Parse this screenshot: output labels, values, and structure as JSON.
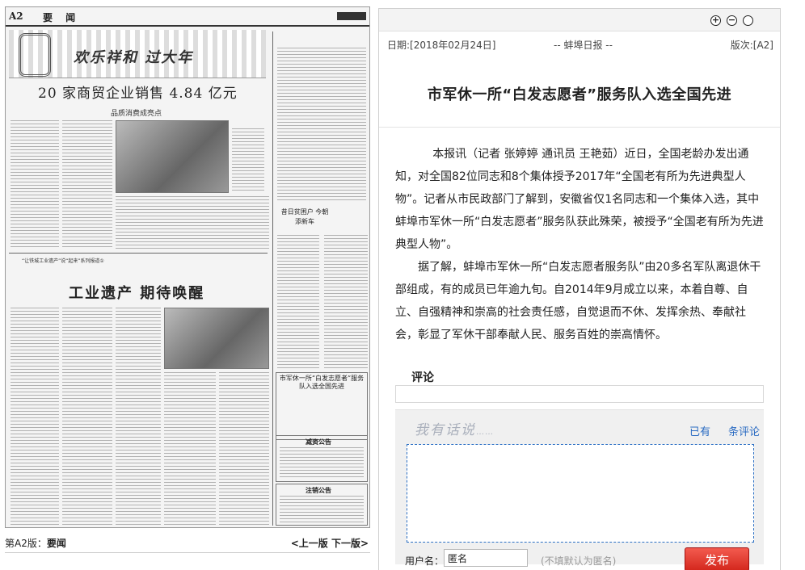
{
  "newspaper": {
    "page_code": "A2",
    "section": "要 闻",
    "festive_banner": "欢乐祥和 过大年",
    "headline_1": "20 家商贸企业销售 4.84 亿元",
    "subhead_1": "品质消费成亮点",
    "headline_2": "工业遗产  期待唤醒",
    "series_intro": "“让铁城工业遗产”说“起来”系列报道①",
    "side_story_title": "昔日贫困户 今朝添新车",
    "side_story_2": "市军休一所“白发志愿者”服务队入选全国先进",
    "notice_1": "减资公告",
    "notice_2": "注销公告",
    "footer_label": "第A2版：",
    "footer_section": "要闻",
    "nav_prev": "<上一版",
    "nav_next": "下一版>"
  },
  "reader": {
    "zoom_in_symbol": "+",
    "zoom_out_symbol": "−",
    "close_symbol": "",
    "date": "日期:[2018年02月24日]",
    "paper_name": "-- 蚌埠日报 --",
    "page_no": "版次:[A2]",
    "title": "市军休一所“白发志愿者”服务队入选全国先进",
    "paragraphs": [
      "本报讯（记者 张婷婷 通讯员 王艳茹）近日，全国老龄办发出通知，对全国82位同志和8个集体授予2017年“全国老有所为先进典型人物”。记者从市民政部门了解到，安徽省仅1名同志和一个集体入选，其中蚌埠市军休一所“白发志愿者”服务队获此殊荣，被授予“全国老有所为先进典型人物”。",
      "据了解，蚌埠市军休一所“白发志愿者服务队”由20多名军队离退休干部组成，有的成员已年逾九旬。自2014年9月成立以来，本着自尊、自立、自强精神和崇高的社会责任感，自觉退而不休、发挥余热、奉献社会，彰显了军休干部奉献人民、服务百姓的崇高情怀。"
    ]
  },
  "comment": {
    "label": "评论",
    "hint": "我有话说",
    "hint_dots": "……",
    "count_prefix": "已有",
    "count_suffix": "条评论",
    "username_label": "用户名：",
    "username_value": "匿名",
    "username_note": "(不填默认为匿名)",
    "submit_label": "发布"
  }
}
